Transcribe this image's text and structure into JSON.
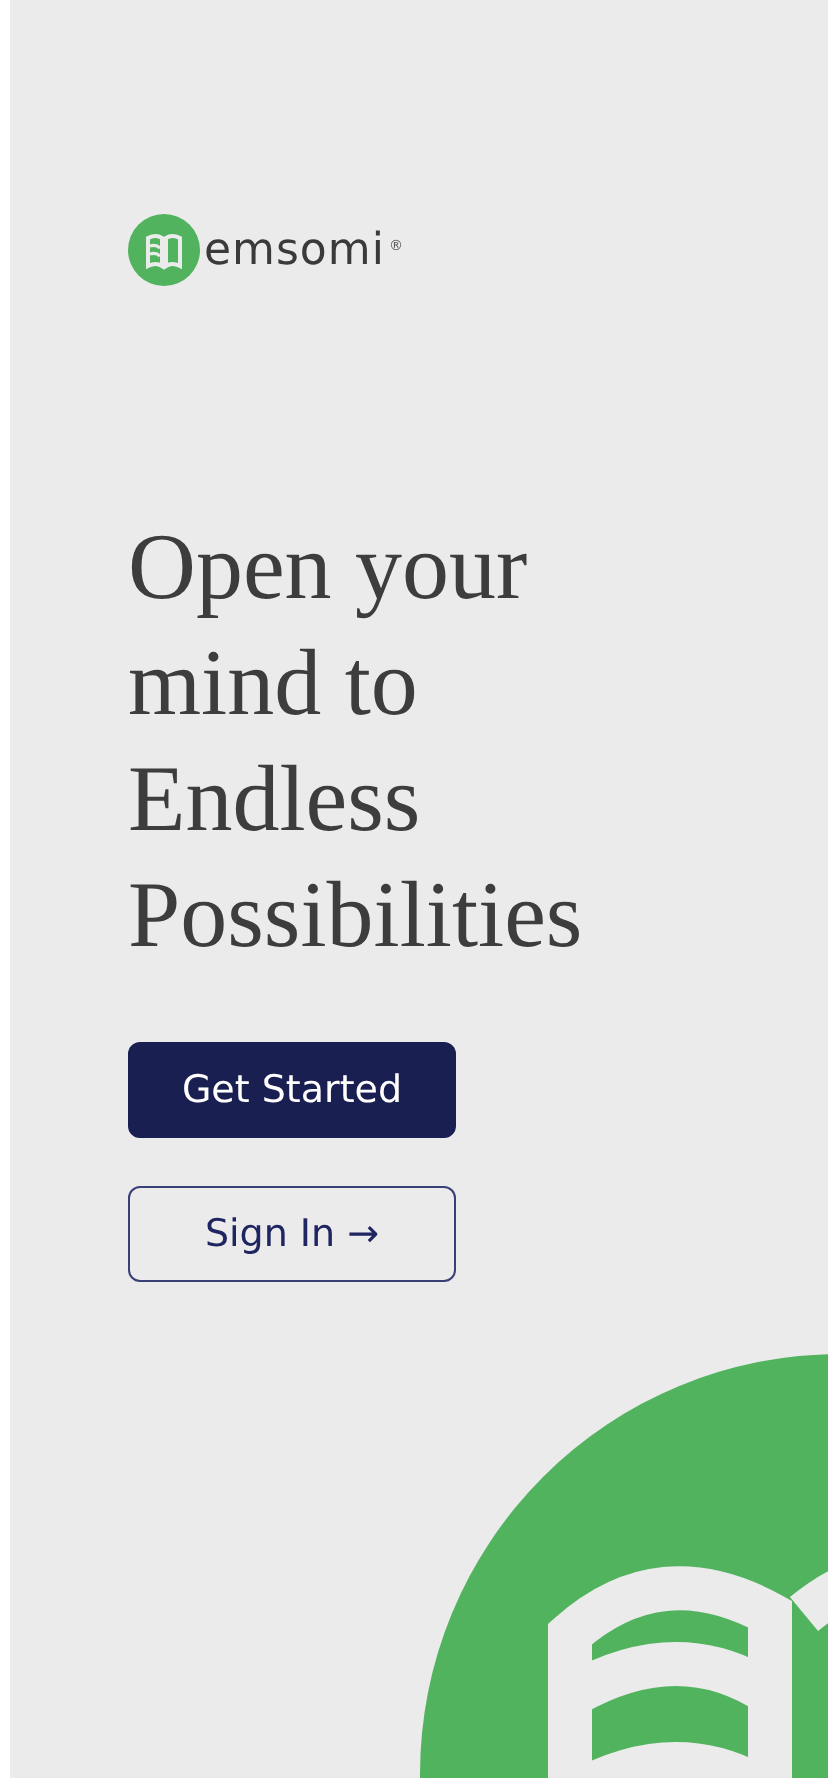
{
  "brand": {
    "name": "emsomi",
    "mark": "®"
  },
  "headline": "Open your mind to Endless Possibilities",
  "buttons": [
    {
      "kind": "primary",
      "label": "Get Started"
    },
    {
      "kind": "outline",
      "label": "Sign In →"
    }
  ]
}
